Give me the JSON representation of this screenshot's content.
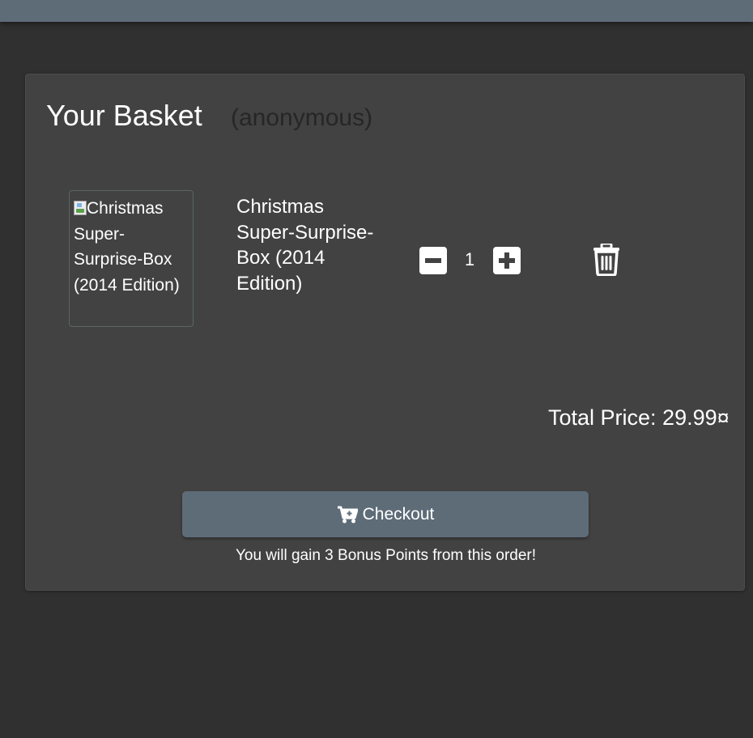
{
  "basket": {
    "title": "Your Basket",
    "user": "(anonymous)"
  },
  "items": [
    {
      "image_alt": "Christmas Super-Surprise-Box (2014 Edition)",
      "name": "Christmas Super-Surprise-Box (2014 Edition)",
      "quantity": "1"
    }
  ],
  "icons": {
    "decrease": "minus-square-icon",
    "increase": "plus-square-icon",
    "delete": "trash-icon",
    "checkout": "cart-icon"
  },
  "total_price": "Total Price: 29.99¤",
  "checkout": {
    "label": "Checkout"
  },
  "bonus_message": "You will gain 3 Bonus Points from this order!",
  "colors": {
    "topbar": "#5e6c78",
    "background": "#303030",
    "card": "#424242",
    "button": "#5e6c78"
  }
}
